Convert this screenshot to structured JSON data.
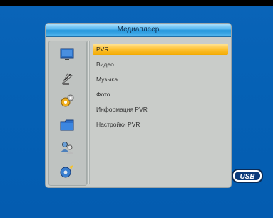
{
  "window": {
    "title": "Медиаплеер"
  },
  "menu": {
    "items": [
      {
        "label": "PVR",
        "selected": true
      },
      {
        "label": "Видео",
        "selected": false
      },
      {
        "label": "Музыка",
        "selected": false
      },
      {
        "label": "Фото",
        "selected": false
      },
      {
        "label": "Информация PVR",
        "selected": false
      },
      {
        "label": "Настройки PVR",
        "selected": false
      }
    ]
  },
  "sidebar_icons": [
    "monitor-icon",
    "satellite-dish-icon",
    "gears-icon",
    "folder-icon",
    "people-icon",
    "media-disc-icon"
  ],
  "usb_badge": {
    "text": "USB"
  },
  "colors": {
    "background": "#0561b5",
    "selection": "#ffc438",
    "panel": "#c9ccc9",
    "title_bar": "#4fb3ee"
  }
}
